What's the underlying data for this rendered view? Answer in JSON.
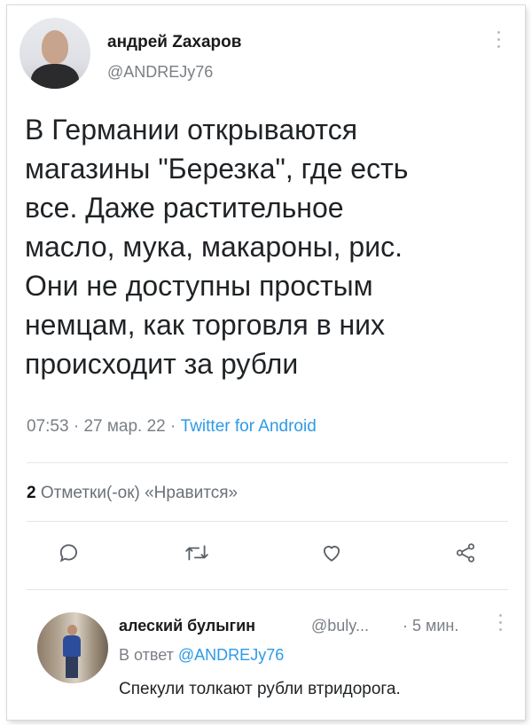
{
  "author": {
    "name": "андрей Zахаров",
    "handle": "@ANDREJy76"
  },
  "tweet": {
    "text": "В Германии открываются\nмагазины \"Березка\", где есть\nвсе. Даже растительное\nмасло, мука, макароны, рис.\nОни не доступны простым\nнемцам, как торговля в них\nпроисходит за рубли",
    "time": "07:53",
    "separator": "·",
    "date": "27 мар. 22",
    "source": "Twitter for Android"
  },
  "stats": {
    "likes_count": "2",
    "likes_label": "Отметки(-ок) «Нравится»"
  },
  "actions": {
    "reply_icon": "reply-icon",
    "retweet_icon": "retweet-icon",
    "like_icon": "heart-icon",
    "share_icon": "share-icon"
  },
  "reply": {
    "name": "алеский булыгин",
    "handle": "@buly...",
    "time": "· 5 мин.",
    "in_reply_prefix": "В ответ",
    "in_reply_handle": "@ANDREJy76",
    "text": "Спекули толкают рубли втридорога."
  },
  "colors": {
    "link": "#2d9ae8",
    "secondary_text": "#7a7f86",
    "primary_text": "#0f1419",
    "divider": "#e3e5e8"
  }
}
